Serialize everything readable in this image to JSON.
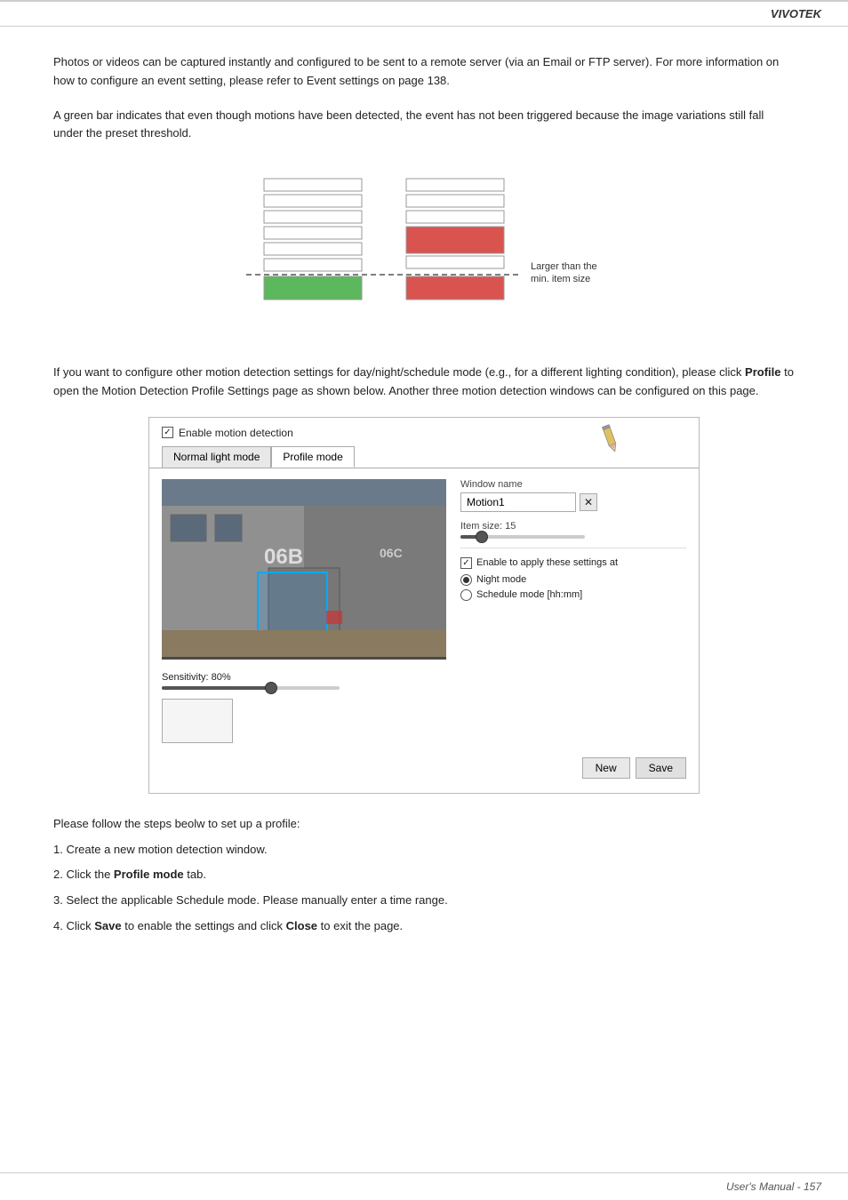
{
  "header": {
    "brand": "VIVOTEK"
  },
  "content": {
    "para1": "Photos or videos can be captured instantly and configured to be sent to a remote server (via an Email or FTP server). For more information on how to configure an event setting, please refer to Event settings on page 138.",
    "para2": "A green bar indicates that even though motions have been detected, the event has not been triggered because the image variations still fall under the preset threshold.",
    "diagram_label": "Larger than the min. item size",
    "para3_intro": "If you want to configure other motion detection settings for day/night/schedule mode (e.g., for a different lighting condition), please click ",
    "para3_bold": "Profile",
    "para3_cont": " to open the Motion Detection Profile Settings page as shown below. Another three motion detection windows can be configured on this page.",
    "enable_label": "Enable motion detection",
    "tab1": "Normal light mode",
    "tab2": "Profile mode",
    "window_name_label": "Window name",
    "window_name_value": "Motion1",
    "item_size_label": "Item size: 15",
    "enable_settings_label": "Enable to apply these settings at",
    "night_mode_label": "Night mode",
    "schedule_mode_label": "Schedule mode [hh:mm]",
    "sensitivity_label": "Sensitivity: 80%",
    "btn_new": "New",
    "btn_save": "Save",
    "label_06b": "06B",
    "label_06c": "06C",
    "steps_intro": "Please follow the steps beolw to set up a profile:",
    "step1": "1. Create a new motion detection window.",
    "step2_pre": "2. Click the ",
    "step2_bold": "Profile mode",
    "step2_post": " tab.",
    "step3": "3. Select the applicable Schedule mode. Please manually enter a time range.",
    "step4_pre": "4. Click ",
    "step4_bold1": "Save",
    "step4_mid": " to enable the settings and click ",
    "step4_bold2": "Close",
    "step4_post": " to exit the page."
  },
  "footer": {
    "text": "User's Manual - 157"
  }
}
